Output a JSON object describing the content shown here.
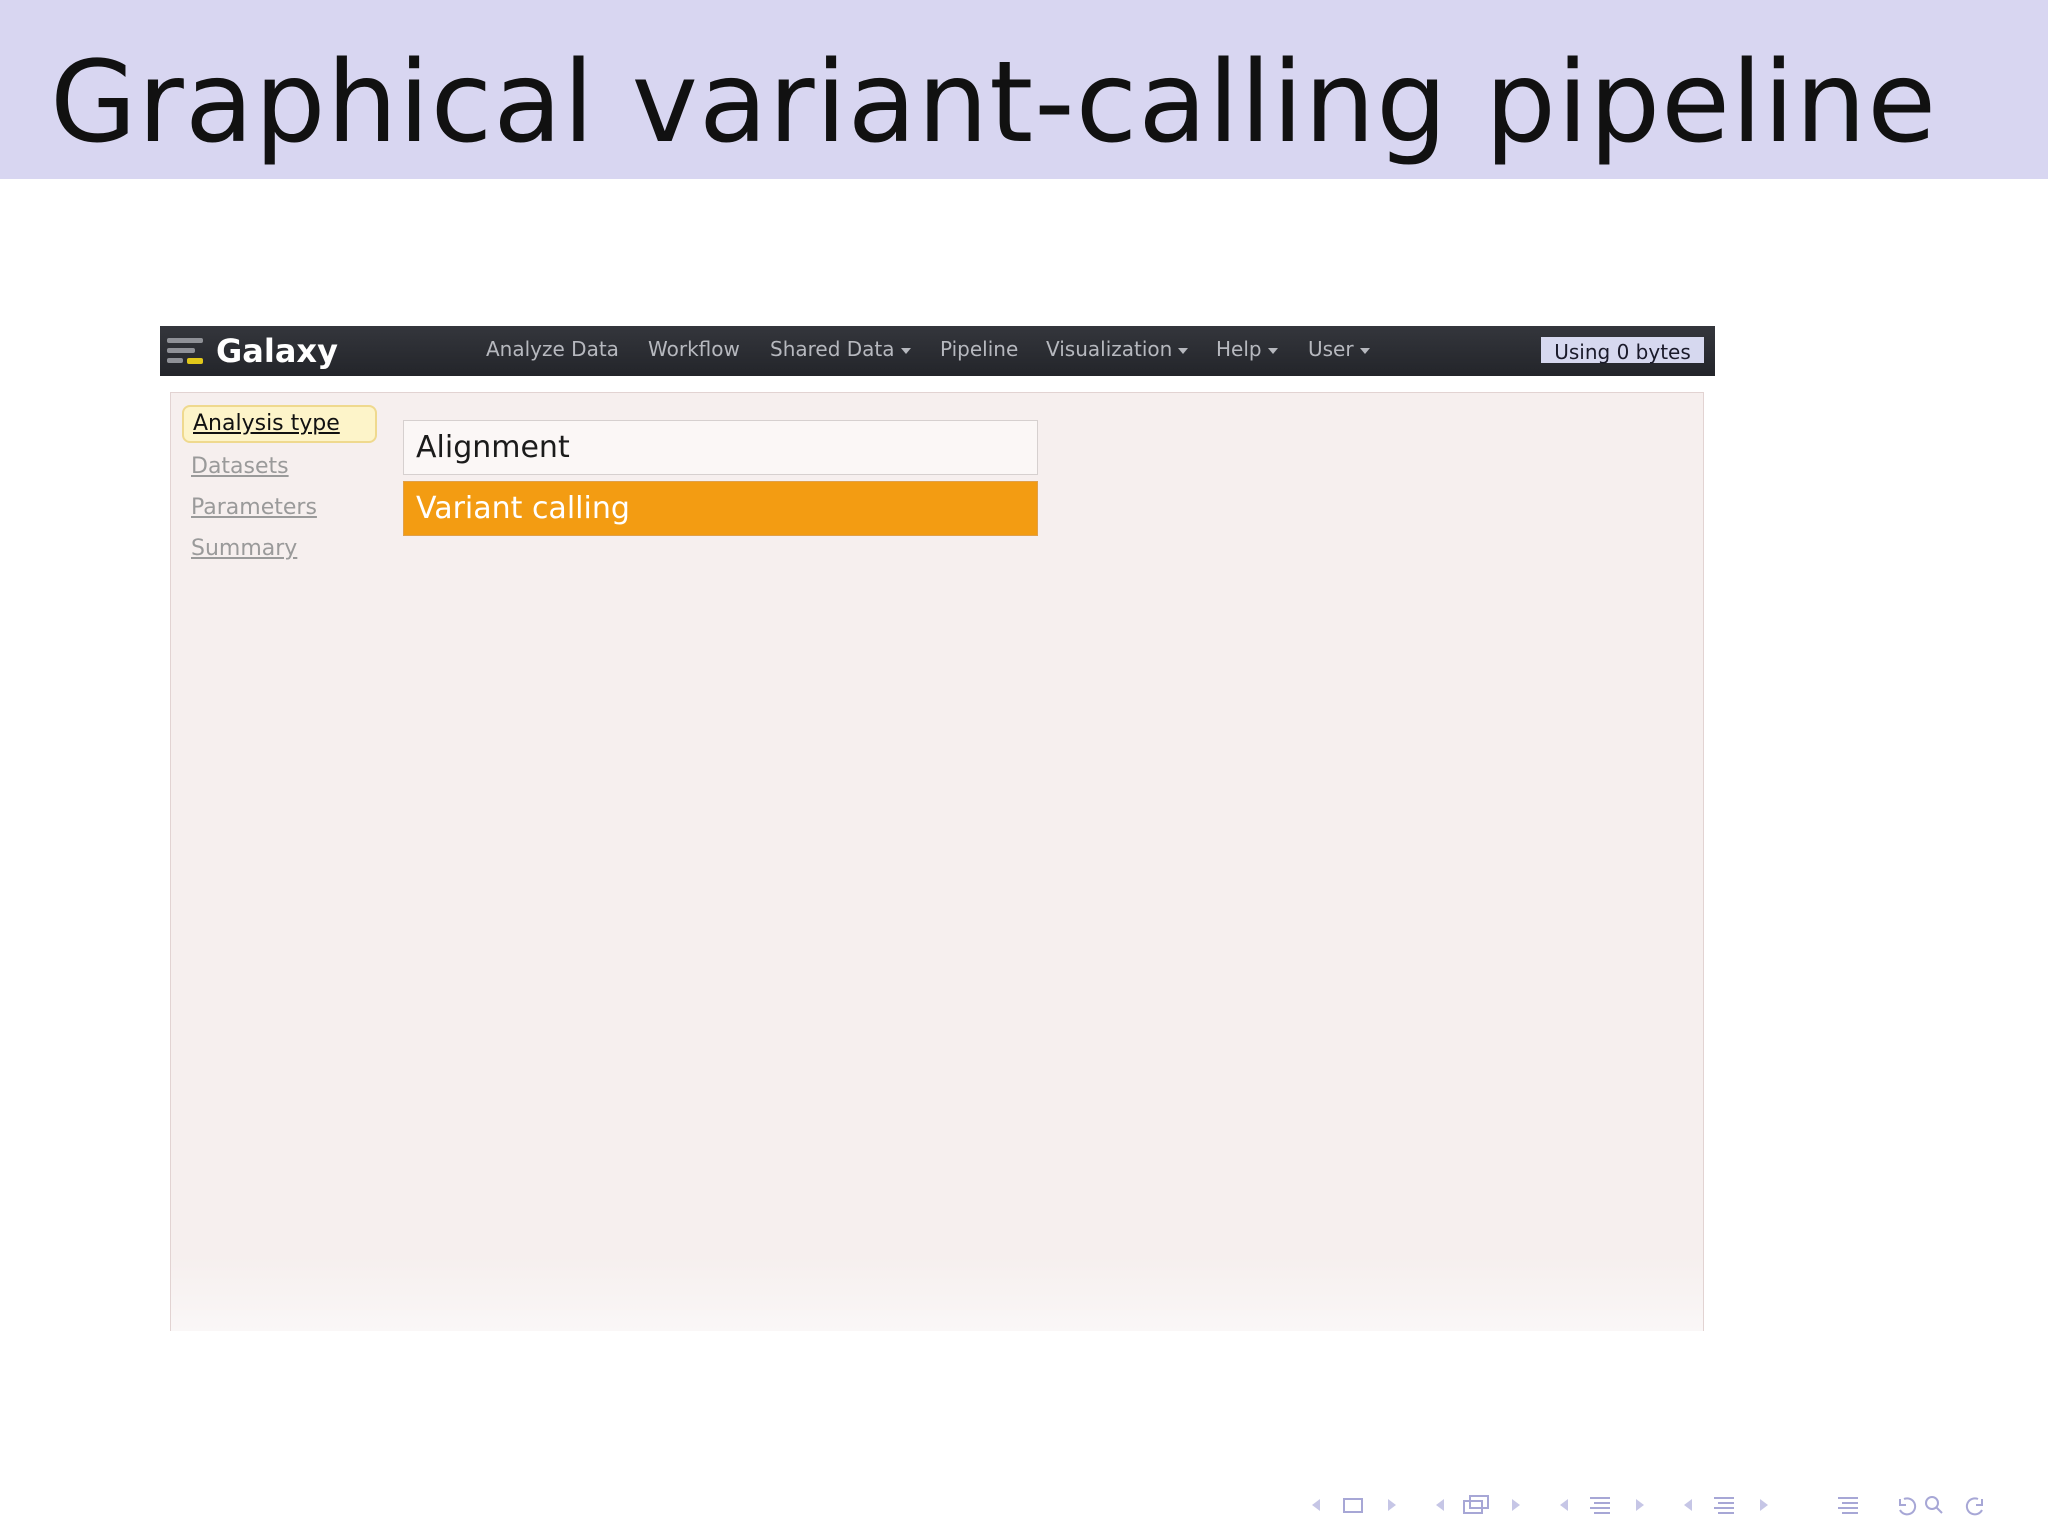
{
  "slide": {
    "title": "Graphical variant-calling pipeline"
  },
  "masthead": {
    "brand": "Galaxy",
    "nav": [
      {
        "label": "Analyze Data",
        "has_dropdown": false
      },
      {
        "label": "Workflow",
        "has_dropdown": false
      },
      {
        "label": "Shared Data",
        "has_dropdown": true
      },
      {
        "label": "Pipeline",
        "has_dropdown": false
      },
      {
        "label": "Visualization",
        "has_dropdown": true
      },
      {
        "label": "Help",
        "has_dropdown": true
      },
      {
        "label": "User",
        "has_dropdown": true
      }
    ],
    "quota": "Using 0 bytes"
  },
  "steps": [
    {
      "label": "Analysis type",
      "active": true
    },
    {
      "label": "Datasets",
      "active": false
    },
    {
      "label": "Parameters",
      "active": false
    },
    {
      "label": "Summary",
      "active": false
    }
  ],
  "options": [
    {
      "label": "Alignment",
      "selected": false
    },
    {
      "label": "Variant calling",
      "selected": true
    }
  ],
  "colors": {
    "title_band": "#d8d6f1",
    "masthead": "#2b2d32",
    "selected_option": "#f39c12",
    "active_step": "#fdf4c9"
  },
  "icons": [
    "galaxy-logo-icon",
    "caret-down-icon",
    "beamer-navigation-icons"
  ]
}
